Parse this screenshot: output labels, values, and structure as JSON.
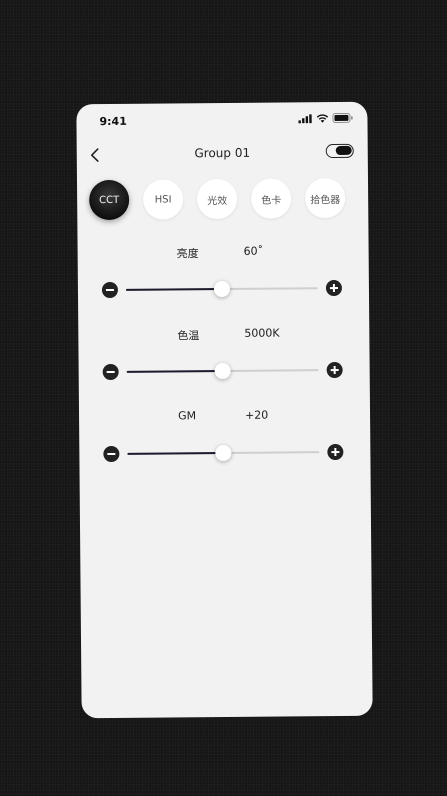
{
  "status_bar": {
    "time": "9:41"
  },
  "nav": {
    "title": "Group 01",
    "power_on": true
  },
  "modes": [
    {
      "label": "CCT",
      "active": true
    },
    {
      "label": "HSI",
      "active": false
    },
    {
      "label": "光效",
      "active": false
    },
    {
      "label": "色卡",
      "active": false
    },
    {
      "label": "拾色器",
      "active": false
    }
  ],
  "params": [
    {
      "label": "亮度",
      "value": "60˚",
      "level": 0.5
    },
    {
      "label": "色温",
      "value": "5000K",
      "level": 0.5
    },
    {
      "label": "GM",
      "value": "+20",
      "level": 0.5
    }
  ],
  "colors": {
    "background": "#161616",
    "panel": "#f2f2f2",
    "active_mode": "#111111",
    "track": "#cfcfcf",
    "track_fill": "#1c1c2e"
  }
}
